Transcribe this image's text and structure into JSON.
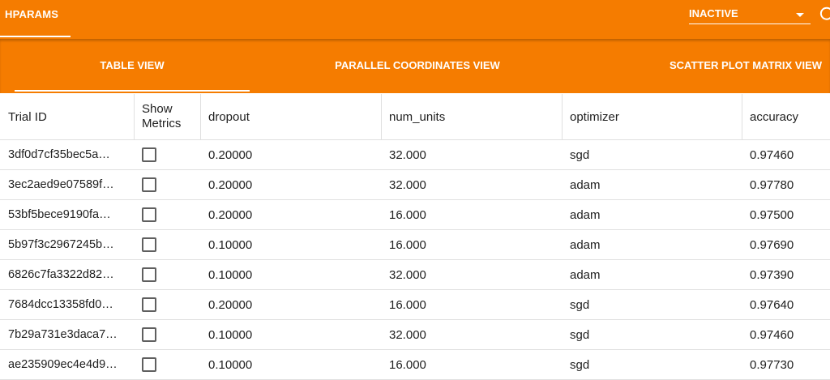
{
  "app": {
    "plugin_tab": "HPARAMS",
    "run_select": {
      "value": "INACTIVE"
    }
  },
  "icons": {
    "dropdown": "chevron-down-icon",
    "reload": "reload-icon",
    "checkbox": "checkbox-unchecked-icon"
  },
  "colors": {
    "toolbar": "#f57c00",
    "text": "#212121",
    "divider": "#e0e0e0"
  },
  "tabs": [
    {
      "label": "TABLE VIEW",
      "active": true
    },
    {
      "label": "PARALLEL COORDINATES VIEW",
      "active": false
    },
    {
      "label": "SCATTER PLOT MATRIX VIEW",
      "active": false
    }
  ],
  "table": {
    "headers": {
      "trial_id": "Trial ID",
      "show_metrics_1": "Show",
      "show_metrics_2": "Metrics",
      "dropout": "dropout",
      "num_units": "num_units",
      "optimizer": "optimizer",
      "accuracy": "accuracy"
    },
    "rows": [
      {
        "trial_id": "3df0d7cf35bec5a…",
        "show_metrics": false,
        "dropout": "0.20000",
        "num_units": "32.000",
        "optimizer": "sgd",
        "accuracy": "0.97460"
      },
      {
        "trial_id": "3ec2aed9e07589f…",
        "show_metrics": false,
        "dropout": "0.20000",
        "num_units": "32.000",
        "optimizer": "adam",
        "accuracy": "0.97780"
      },
      {
        "trial_id": "53bf5bece9190fa…",
        "show_metrics": false,
        "dropout": "0.20000",
        "num_units": "16.000",
        "optimizer": "adam",
        "accuracy": "0.97500"
      },
      {
        "trial_id": "5b97f3c2967245b…",
        "show_metrics": false,
        "dropout": "0.10000",
        "num_units": "16.000",
        "optimizer": "adam",
        "accuracy": "0.97690"
      },
      {
        "trial_id": "6826c7fa3322d82…",
        "show_metrics": false,
        "dropout": "0.10000",
        "num_units": "32.000",
        "optimizer": "adam",
        "accuracy": "0.97390"
      },
      {
        "trial_id": "7684dcc13358fd0…",
        "show_metrics": false,
        "dropout": "0.20000",
        "num_units": "16.000",
        "optimizer": "sgd",
        "accuracy": "0.97640"
      },
      {
        "trial_id": "7b29a731e3daca7…",
        "show_metrics": false,
        "dropout": "0.10000",
        "num_units": "32.000",
        "optimizer": "sgd",
        "accuracy": "0.97460"
      },
      {
        "trial_id": "ae235909ec4e4d9…",
        "show_metrics": false,
        "dropout": "0.10000",
        "num_units": "16.000",
        "optimizer": "sgd",
        "accuracy": "0.97730"
      }
    ]
  }
}
